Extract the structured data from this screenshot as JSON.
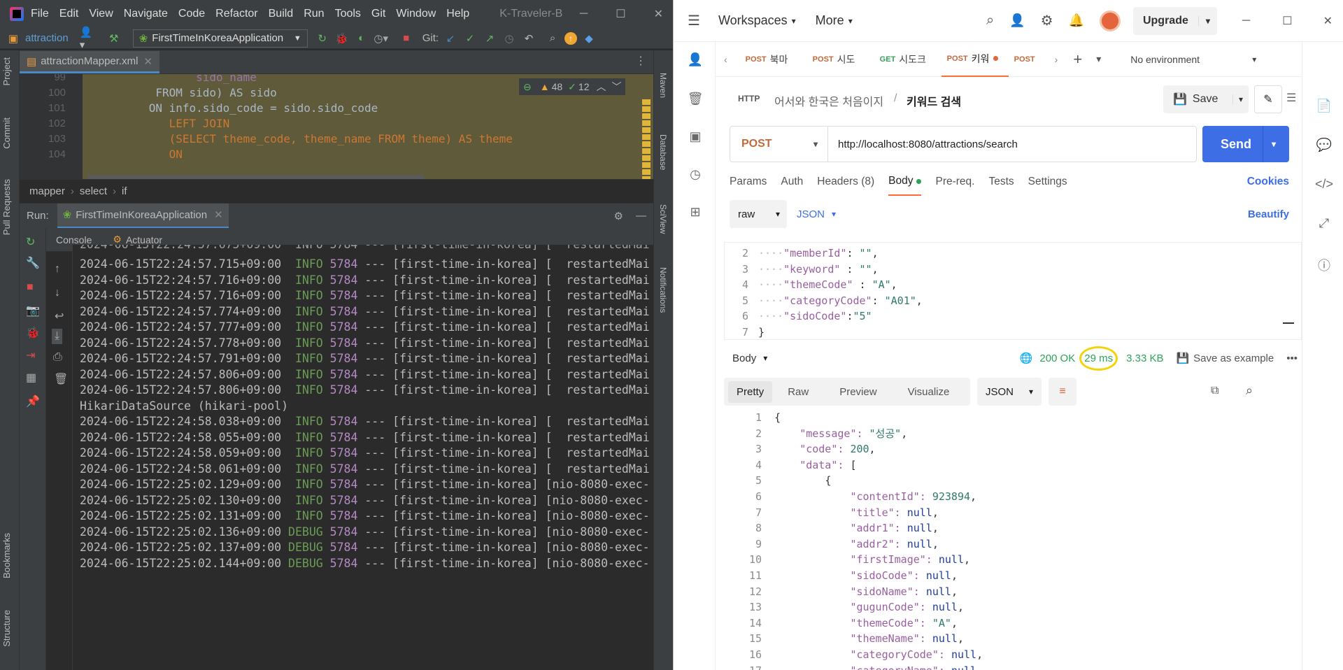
{
  "ide": {
    "menu": [
      "File",
      "Edit",
      "View",
      "Navigate",
      "Code",
      "Refactor",
      "Build",
      "Run",
      "Tools",
      "Git",
      "Window",
      "Help"
    ],
    "window_title": "K-Traveler-B",
    "project": "attraction",
    "run_config": "FirstTimeInKoreaApplication",
    "git_label": "Git:",
    "left_tools": [
      "Project",
      "Commit",
      "Pull Requests",
      "Bookmarks",
      "Structure"
    ],
    "right_tools": [
      "Maven",
      "Database",
      "SciView",
      "Notifications"
    ],
    "editor_tab": "attractionMapper.xml",
    "warnings": "48",
    "weak_warnings": "12",
    "code_lines": [
      {
        "n": "99",
        "text": "                sido_name"
      },
      {
        "n": "100",
        "text": "          FROM sido) AS sido"
      },
      {
        "n": "101",
        "text": "         ON info.sido_code = sido.sido_code"
      },
      {
        "n": "102",
        "text": "            LEFT JOIN"
      },
      {
        "n": "103",
        "text": "            (SELECT theme_code, theme_name FROM theme) AS theme"
      },
      {
        "n": "104",
        "text": "            ON"
      }
    ],
    "breadcrumb": [
      "mapper",
      "select",
      "if"
    ],
    "run_label": "Run:",
    "run_tab": "FirstTimeInKoreaApplication",
    "console_tabs": [
      "Console",
      "Actuator"
    ],
    "console_lines": [
      {
        "ts": "2024-06-15T22:24:57.715+09:00",
        "lvl": "INFO",
        "pid": "5784",
        "rest": " --- [first-time-in-korea] [  restartedMai"
      },
      {
        "ts": "2024-06-15T22:24:57.716+09:00",
        "lvl": "INFO",
        "pid": "5784",
        "rest": " --- [first-time-in-korea] [  restartedMai"
      },
      {
        "ts": "2024-06-15T22:24:57.716+09:00",
        "lvl": "INFO",
        "pid": "5784",
        "rest": " --- [first-time-in-korea] [  restartedMai"
      },
      {
        "ts": "2024-06-15T22:24:57.774+09:00",
        "lvl": "INFO",
        "pid": "5784",
        "rest": " --- [first-time-in-korea] [  restartedMai"
      },
      {
        "ts": "2024-06-15T22:24:57.777+09:00",
        "lvl": "INFO",
        "pid": "5784",
        "rest": " --- [first-time-in-korea] [  restartedMai"
      },
      {
        "ts": "2024-06-15T22:24:57.778+09:00",
        "lvl": "INFO",
        "pid": "5784",
        "rest": " --- [first-time-in-korea] [  restartedMai"
      },
      {
        "ts": "2024-06-15T22:24:57.791+09:00",
        "lvl": "INFO",
        "pid": "5784",
        "rest": " --- [first-time-in-korea] [  restartedMai"
      },
      {
        "ts": "2024-06-15T22:24:57.806+09:00",
        "lvl": "INFO",
        "pid": "5784",
        "rest": " --- [first-time-in-korea] [  restartedMai"
      },
      {
        "ts": "2024-06-15T22:24:57.806+09:00",
        "lvl": "INFO",
        "pid": "5784",
        "rest": " --- [first-time-in-korea] [  restartedMai"
      },
      {
        "plain": "HikariDataSource (hikari-pool)"
      },
      {
        "ts": "2024-06-15T22:24:58.038+09:00",
        "lvl": "INFO",
        "pid": "5784",
        "rest": " --- [first-time-in-korea] [  restartedMai"
      },
      {
        "ts": "2024-06-15T22:24:58.055+09:00",
        "lvl": "INFO",
        "pid": "5784",
        "rest": " --- [first-time-in-korea] [  restartedMai"
      },
      {
        "ts": "2024-06-15T22:24:58.059+09:00",
        "lvl": "INFO",
        "pid": "5784",
        "rest": " --- [first-time-in-korea] [  restartedMai"
      },
      {
        "ts": "2024-06-15T22:24:58.061+09:00",
        "lvl": "INFO",
        "pid": "5784",
        "rest": " --- [first-time-in-korea] [  restartedMai"
      },
      {
        "ts": "2024-06-15T22:25:02.129+09:00",
        "lvl": "INFO",
        "pid": "5784",
        "rest": " --- [first-time-in-korea] [nio-8080-exec-"
      },
      {
        "ts": "2024-06-15T22:25:02.130+09:00",
        "lvl": "INFO",
        "pid": "5784",
        "rest": " --- [first-time-in-korea] [nio-8080-exec-"
      },
      {
        "ts": "2024-06-15T22:25:02.131+09:00",
        "lvl": "INFO",
        "pid": "5784",
        "rest": " --- [first-time-in-korea] [nio-8080-exec-"
      },
      {
        "ts": "2024-06-15T22:25:02.136+09:00",
        "lvl": "DEBUG",
        "pid": "5784",
        "rest": " --- [first-time-in-korea] [nio-8080-exec-"
      },
      {
        "ts": "2024-06-15T22:25:02.137+09:00",
        "lvl": "DEBUG",
        "pid": "5784",
        "rest": " --- [first-time-in-korea] [nio-8080-exec-"
      },
      {
        "ts": "2024-06-15T22:25:02.144+09:00",
        "lvl": "DEBUG",
        "pid": "5784",
        "rest": " --- [first-time-in-korea] [nio-8080-exec-"
      }
    ]
  },
  "postman": {
    "workspaces": "Workspaces",
    "more": "More",
    "upgrade": "Upgrade",
    "tabs": [
      {
        "method": "POST",
        "name": "북마"
      },
      {
        "method": "POST",
        "name": "시도"
      },
      {
        "method": "GET",
        "name": "시도크"
      },
      {
        "method": "POST",
        "name": "키워"
      },
      {
        "method": "POST",
        "name": ""
      }
    ],
    "environment": "No environment",
    "breadcrumb_parent": "어서와 한국은 처음이지",
    "breadcrumb_sep": "/",
    "request_name": "키워드 검색",
    "save": "Save",
    "method": "POST",
    "url": "http://localhost:8080/attractions/search",
    "send": "Send",
    "req_tabs": [
      "Params",
      "Auth",
      "Headers (8)",
      "Body",
      "Pre-req.",
      "Tests",
      "Settings"
    ],
    "cookies": "Cookies",
    "body_mode": "raw",
    "body_lang": "JSON",
    "beautify": "Beautify",
    "body_lines": [
      {
        "n": "2",
        "k": "memberId",
        "sep": ": ",
        "v": "\"\"",
        "tail": ","
      },
      {
        "n": "3",
        "k": "keyword",
        "sep": " : ",
        "v": "\"\"",
        "tail": ","
      },
      {
        "n": "4",
        "k": "themeCode",
        "sep": " : ",
        "v": "\"A\"",
        "tail": ","
      },
      {
        "n": "5",
        "k": "categoryCode",
        "sep": ": ",
        "v": "\"A01\"",
        "tail": ","
      },
      {
        "n": "6",
        "k": "sidoCode",
        "sep": ":",
        "v": "\"5\"",
        "tail": ""
      },
      {
        "n": "7",
        "plain": "}"
      }
    ],
    "res_body_label": "Body",
    "status": "200 OK",
    "time": "29 ms",
    "size": "3.33 KB",
    "save_example": "Save as example",
    "res_views": [
      "Pretty",
      "Raw",
      "Preview",
      "Visualize"
    ],
    "res_lang": "JSON",
    "res_lines": [
      {
        "n": "1",
        "indent": "",
        "plain": "{"
      },
      {
        "n": "2",
        "indent": "    ",
        "k": "message",
        "v": "\"성공\"",
        "type": "s"
      },
      {
        "n": "3",
        "indent": "    ",
        "k": "code",
        "v": "200",
        "type": "n"
      },
      {
        "n": "4",
        "indent": "    ",
        "k": "data",
        "v": "[",
        "type": "p"
      },
      {
        "n": "5",
        "indent": "        ",
        "plain": "{"
      },
      {
        "n": "6",
        "indent": "            ",
        "k": "contentId",
        "v": "923894",
        "type": "n"
      },
      {
        "n": "7",
        "indent": "            ",
        "k": "title",
        "v": "null",
        "type": "null"
      },
      {
        "n": "8",
        "indent": "            ",
        "k": "addr1",
        "v": "null",
        "type": "null"
      },
      {
        "n": "9",
        "indent": "            ",
        "k": "addr2",
        "v": "null",
        "type": "null"
      },
      {
        "n": "10",
        "indent": "            ",
        "k": "firstImage",
        "v": "null",
        "type": "null"
      },
      {
        "n": "11",
        "indent": "            ",
        "k": "sidoCode",
        "v": "null",
        "type": "null"
      },
      {
        "n": "12",
        "indent": "            ",
        "k": "sidoName",
        "v": "null",
        "type": "null"
      },
      {
        "n": "13",
        "indent": "            ",
        "k": "gugunCode",
        "v": "null",
        "type": "null"
      },
      {
        "n": "14",
        "indent": "            ",
        "k": "themeCode",
        "v": "\"A\"",
        "type": "s"
      },
      {
        "n": "15",
        "indent": "            ",
        "k": "themeName",
        "v": "null",
        "type": "null"
      },
      {
        "n": "16",
        "indent": "            ",
        "k": "categoryCode",
        "v": "null",
        "type": "null"
      },
      {
        "n": "17",
        "indent": "            ",
        "k": "categoryName",
        "v": "null",
        "type": "null"
      }
    ]
  }
}
